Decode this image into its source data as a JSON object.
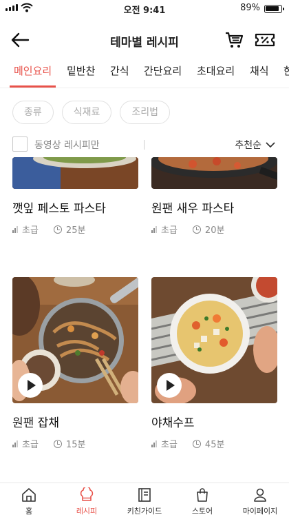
{
  "status_bar": {
    "time": "오전 9:41",
    "battery": "89%"
  },
  "header": {
    "title": "테마별 레시피"
  },
  "tabs": [
    {
      "label": "메인요리",
      "active": true
    },
    {
      "label": "밑반찬"
    },
    {
      "label": "간식"
    },
    {
      "label": "간단요리"
    },
    {
      "label": "초대요리"
    },
    {
      "label": "채식"
    },
    {
      "label": "한"
    }
  ],
  "filters": [
    "종류",
    "식재료",
    "조리법"
  ],
  "video_only_label": "동영상 레시피만",
  "sort_label": "추천순",
  "recipes": [
    {
      "name": "깻잎 페스토 파스타",
      "level": "초급",
      "time": "25분",
      "video": false
    },
    {
      "name": "원팬 새우 파스타",
      "level": "초급",
      "time": "20분",
      "video": false
    },
    {
      "name": "원팬 잡채",
      "level": "초급",
      "time": "15분",
      "video": true
    },
    {
      "name": "야채수프",
      "level": "초급",
      "time": "45분",
      "video": true
    }
  ],
  "bottom_nav": [
    {
      "label": "홈",
      "icon": "home-icon"
    },
    {
      "label": "레시피",
      "icon": "chef-hat-icon",
      "active": true
    },
    {
      "label": "키친가이드",
      "icon": "book-icon"
    },
    {
      "label": "스토어",
      "icon": "shopping-bag-icon"
    },
    {
      "label": "마이페이지",
      "icon": "person-icon"
    }
  ],
  "colors": {
    "accent": "#e8524a",
    "text": "#222222",
    "muted": "#888888"
  }
}
